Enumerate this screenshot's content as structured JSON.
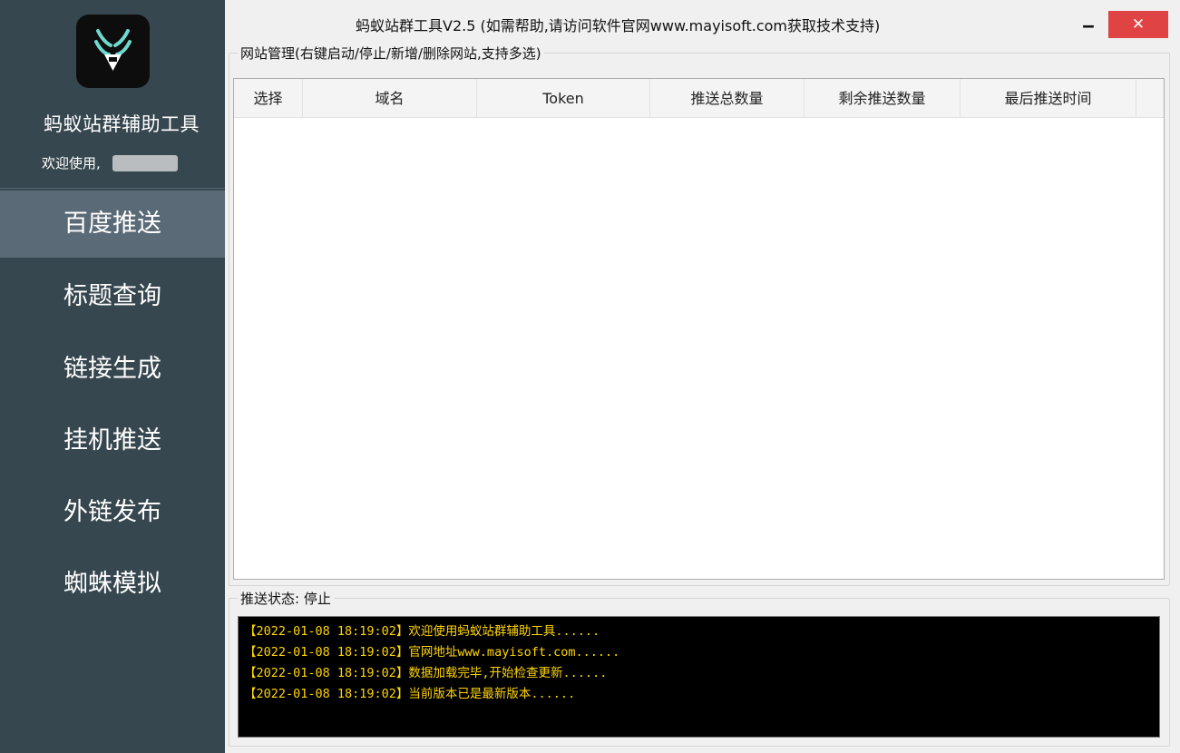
{
  "window": {
    "title": "蚂蚁站群工具V2.5   (如需帮助,请访问软件官网www.mayisoft.com获取技术支持)",
    "minimize_label": "‒",
    "close_label": "✕"
  },
  "sidebar": {
    "logo_icon": "ant-logo-icon",
    "app_name": "蚂蚁站群辅助工具",
    "welcome": "欢迎使用,",
    "items": [
      {
        "label": "百度推送",
        "active": true
      },
      {
        "label": "标题查询",
        "active": false
      },
      {
        "label": "链接生成",
        "active": false
      },
      {
        "label": "挂机推送",
        "active": false
      },
      {
        "label": "外链发布",
        "active": false
      },
      {
        "label": "蜘蛛模拟",
        "active": false
      }
    ]
  },
  "site_panel": {
    "label": "网站管理(右键启动/停止/新增/删除网站,支持多选)",
    "columns": [
      "选择",
      "域名",
      "Token",
      "推送总数量",
      "剩余推送数量",
      "最后推送时间"
    ],
    "rows": []
  },
  "status_panel": {
    "label": "推送状态: 停止",
    "log": [
      "【2022-01-08 18:19:02】欢迎使用蚂蚁站群辅助工具......",
      "【2022-01-08 18:19:02】官网地址www.mayisoft.com......",
      "【2022-01-08 18:19:02】数据加载完毕,开始检查更新......",
      "【2022-01-08 18:19:02】当前版本已是最新版本......"
    ]
  },
  "colors": {
    "sidebar_bg": "#37474f",
    "sidebar_active": "#5a6a76",
    "close_button": "#e04343",
    "log_text": "#ffd500",
    "log_bg": "#000000",
    "logo_accent": "#6fd8cf"
  }
}
